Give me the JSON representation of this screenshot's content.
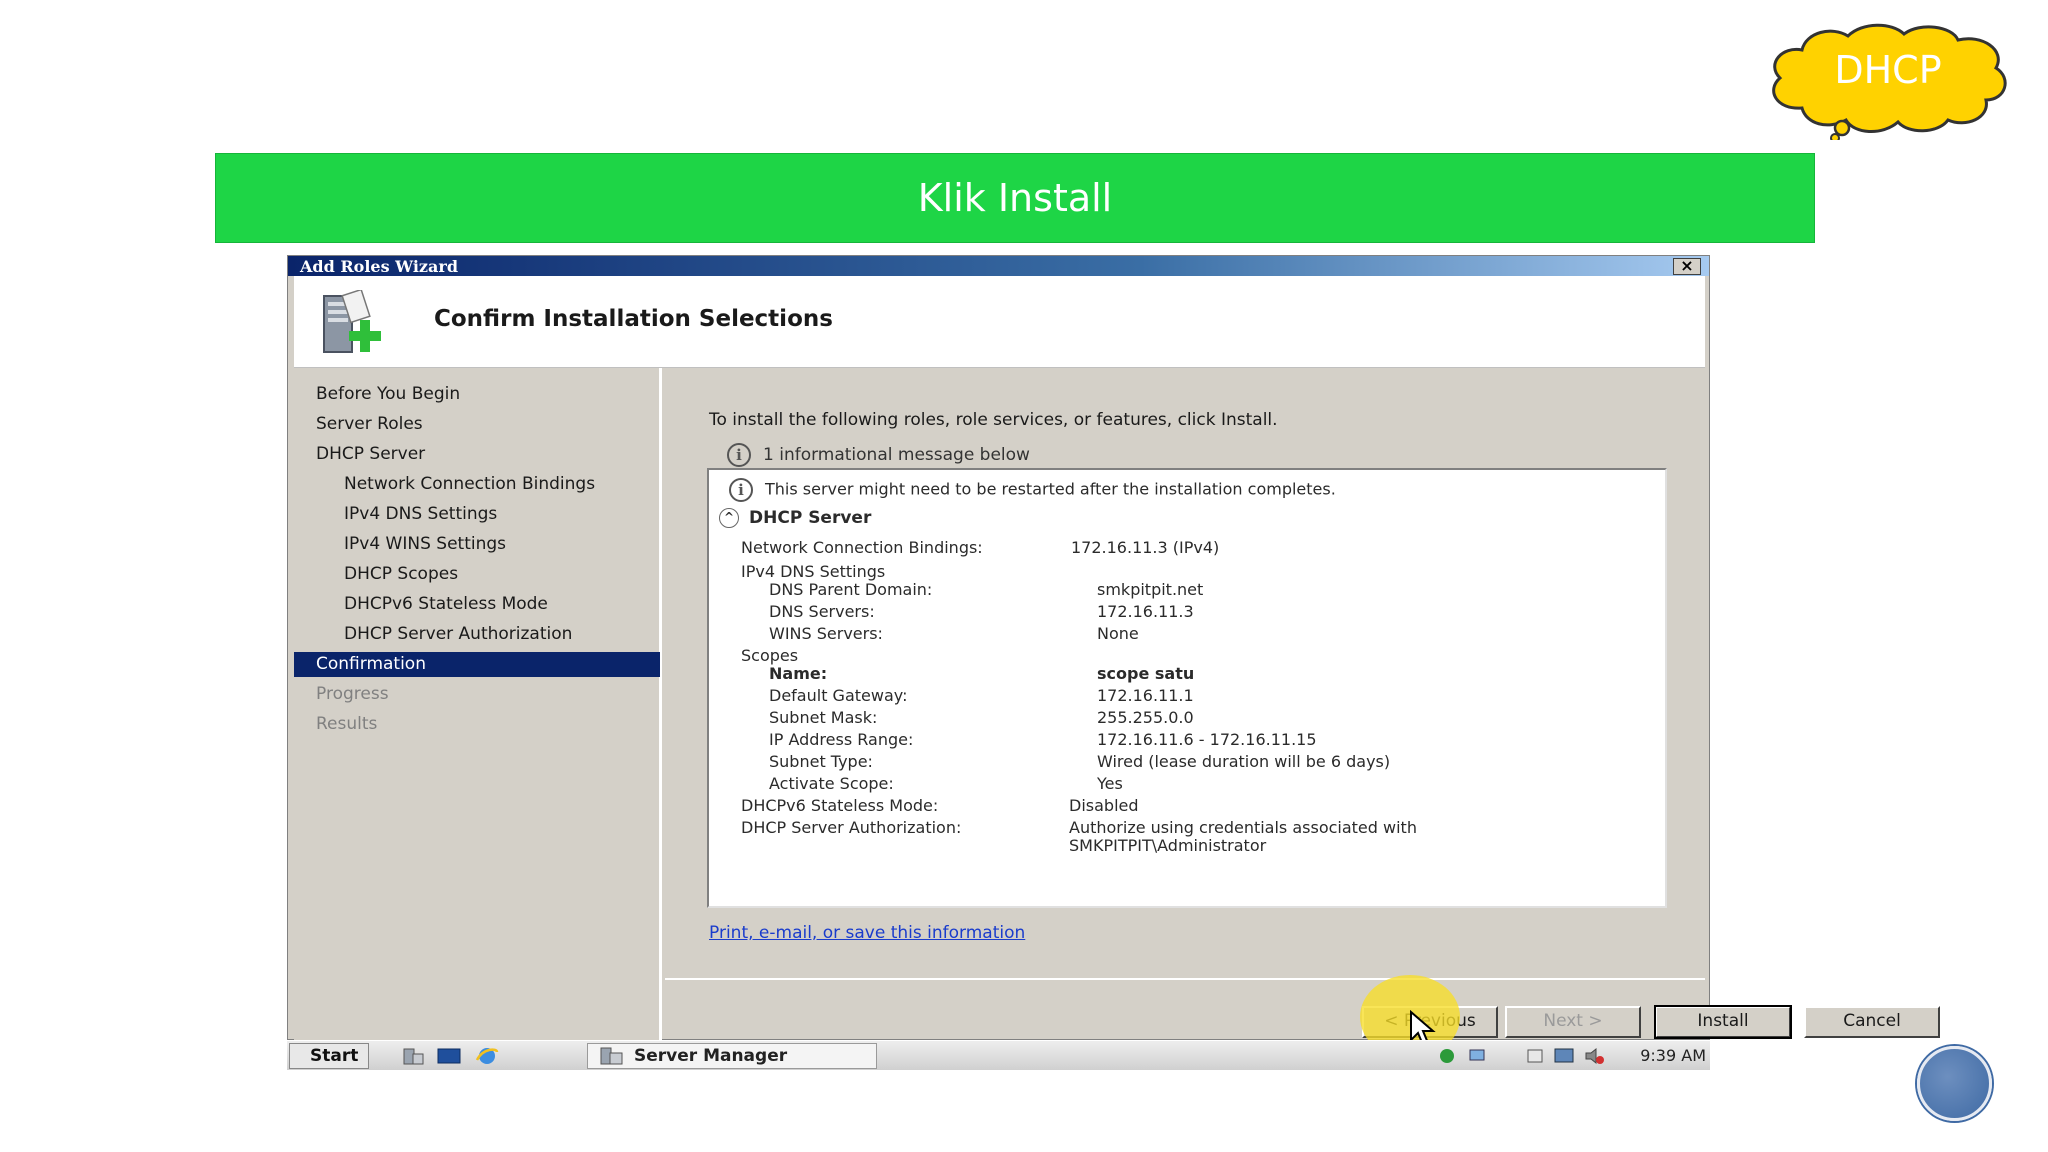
{
  "badge": {
    "label": "DHCP"
  },
  "banner": {
    "text": "Klik Install"
  },
  "wizard": {
    "title": "Add Roles Wizard",
    "close_label": "×",
    "header_title": "Confirm Installation Selections",
    "nav": [
      {
        "label": "Before You Begin",
        "state": "normal"
      },
      {
        "label": "Server Roles",
        "state": "normal"
      },
      {
        "label": "DHCP Server",
        "state": "normal"
      },
      {
        "label": "Network Connection Bindings",
        "state": "sub"
      },
      {
        "label": "IPv4 DNS Settings",
        "state": "sub"
      },
      {
        "label": "IPv4 WINS Settings",
        "state": "sub"
      },
      {
        "label": "DHCP Scopes",
        "state": "sub"
      },
      {
        "label": "DHCPv6 Stateless Mode",
        "state": "sub"
      },
      {
        "label": "DHCP Server Authorization",
        "state": "sub"
      },
      {
        "label": "Confirmation",
        "state": "active"
      },
      {
        "label": "Progress",
        "state": "disabled"
      },
      {
        "label": "Results",
        "state": "disabled"
      }
    ],
    "intro": "To install the following roles, role services, or features, click Install.",
    "info_message": "1 informational message below",
    "details": {
      "warning": "This server might need to be restarted after the installation completes.",
      "section_title": "DHCP Server",
      "bindings_label": "Network Connection Bindings:",
      "bindings_value": "172.16.11.3 (IPv4)",
      "dns_settings_label": "IPv4 DNS Settings",
      "dns_domain_label": "DNS Parent Domain:",
      "dns_domain_value": "smkpitpit.net",
      "dns_servers_label": "DNS Servers:",
      "dns_servers_value": "172.16.11.3",
      "wins_label": "WINS Servers:",
      "wins_value": "None",
      "scopes_label": "Scopes",
      "name_label": "Name:",
      "name_value": "scope satu",
      "gateway_label": "Default Gateway:",
      "gateway_value": "172.16.11.1",
      "mask_label": "Subnet Mask:",
      "mask_value": "255.255.0.0",
      "range_label": "IP Address Range:",
      "range_value": "172.16.11.6 - 172.16.11.15",
      "subnet_type_label": "Subnet Type:",
      "subnet_type_value": "Wired (lease duration will be 6 days)",
      "activate_label": "Activate Scope:",
      "activate_value": "Yes",
      "stateless_label": "DHCPv6 Stateless Mode:",
      "stateless_value": "Disabled",
      "auth_label": "DHCP Server Authorization:",
      "auth_value_1": "Authorize using credentials associated with",
      "auth_value_2": "SMKPITPIT\\Administrator"
    },
    "link": "Print, e-mail, or save this information",
    "buttons": {
      "previous": "< Previous",
      "next": "Next >",
      "install": "Install",
      "cancel": "Cancel"
    }
  },
  "taskbar": {
    "start": "Start",
    "task": "Server Manager",
    "clock": "9:39 AM"
  },
  "colors": {
    "banner": "#1ed546",
    "cloud": "#ffd200",
    "selection": "#0a246a",
    "highlight": "#f7de28"
  }
}
